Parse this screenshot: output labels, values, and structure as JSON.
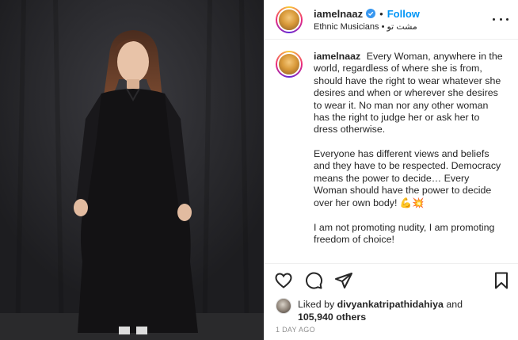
{
  "header": {
    "username": "iamelnaaz",
    "dot": "•",
    "follow_label": "Follow",
    "audio_line": "Ethnic Musicians • مشت تو"
  },
  "caption": {
    "username": "iamelnaaz",
    "paragraphs": [
      "Every Woman, anywhere in the world, regardless of where she is from, should have the right to wear whatever she desires and when or wherever she desires to wear it. No man nor any other woman has the right to judge her or ask her to dress otherwise.",
      "Everyone has different views and beliefs and they have to be respected. Democracy means the power to decide… Every Woman should have the power to decide over her own body!",
      "I am not promoting nudity, I am promoting freedom of choice!"
    ],
    "emojis": "💪💥"
  },
  "likes": {
    "prefix": "Liked by",
    "liker": "divyankatripathidahiya",
    "joiner": "and",
    "others": "105,940 others"
  },
  "timestamp": "1 DAY AGO",
  "icons": {
    "verified": "verified-badge-icon",
    "like": "heart-icon",
    "comment": "comment-icon",
    "share": "share-icon",
    "save": "bookmark-icon",
    "more": "more-options-icon"
  },
  "colors": {
    "accent": "#0095f6",
    "text": "#262626",
    "muted": "#8e8e8e",
    "border": "#efefef"
  }
}
